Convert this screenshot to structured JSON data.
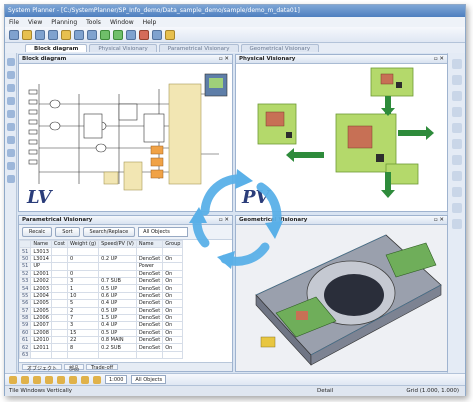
{
  "window": {
    "title": "System Planner - [C:/SystemPlanner/SP_Info_demo/Data_sample_demo/sample/demo_m_data01]"
  },
  "menu": [
    "File",
    "View",
    "Planning",
    "Tools",
    "Window",
    "Help"
  ],
  "tabs": [
    {
      "label": "Block diagram",
      "active": true
    },
    {
      "label": "Physical Visionary",
      "active": false
    },
    {
      "label": "Parametrical Visionary",
      "active": false
    },
    {
      "label": "Geometrical Visionary",
      "active": false
    }
  ],
  "panes": {
    "block": {
      "title": "Block diagram",
      "mark": "LV"
    },
    "physical": {
      "title": "Physical Visionary",
      "mark": "PV"
    },
    "parametrical": {
      "title": "Parametrical Visionary",
      "buttons": [
        "Recalc",
        "Sort",
        "Search/Replace"
      ],
      "filter": "All Objects",
      "columns": [
        "Name",
        "Cost",
        "Weight (g)",
        "Speed/PV (V)",
        "Name",
        "Group"
      ],
      "rows": [
        [
          "51",
          "L3013",
          "",
          "",
          "",
          "",
          ""
        ],
        [
          "50",
          "L3014",
          "",
          "0",
          "0.2 UP",
          "DenoSet",
          "On"
        ],
        [
          "51",
          "UP",
          "",
          "",
          "",
          "Power",
          ""
        ],
        [
          "52",
          "L2001",
          "",
          "0",
          "",
          "DenoSet",
          "On"
        ],
        [
          "53",
          "L2002",
          "",
          "3",
          "0.7 SUB",
          "DenoSet",
          "On"
        ],
        [
          "54",
          "L2003",
          "",
          "1",
          "0.5 UP",
          "DenoSet",
          "On"
        ],
        [
          "55",
          "L2004",
          "",
          "10",
          "0.6 UP",
          "DenoSet",
          "On"
        ],
        [
          "56",
          "L2005",
          "",
          "5",
          "0.4 UP",
          "DenoSet",
          "On"
        ],
        [
          "57",
          "L2005",
          "",
          "2",
          "0.5 UP",
          "DenoSet",
          "On"
        ],
        [
          "58",
          "L2006",
          "",
          "7",
          "1.5 UP",
          "DenoSet",
          "On"
        ],
        [
          "59",
          "L2007",
          "",
          "3",
          "0.4 UP",
          "DenoSet",
          "On"
        ],
        [
          "60",
          "L2008",
          "",
          "15",
          "0.5 UP",
          "DenoSet",
          "On"
        ],
        [
          "61",
          "L2010",
          "",
          "22",
          "0.8 MAIN",
          "DenoSet",
          "On"
        ],
        [
          "62",
          "L2011",
          "",
          "8",
          "0.2 SUB",
          "DenoSet",
          "On"
        ],
        [
          "63",
          "",
          "",
          "",
          "",
          "",
          ""
        ]
      ],
      "bottom_tabs": [
        "オブジェクト",
        "部品",
        "Trade-off"
      ]
    },
    "geometrical": {
      "title": "Geometrical Visionary"
    }
  },
  "bottombar": {
    "zoom": "1:000",
    "filter": "All Objects"
  },
  "status": {
    "left": "Tile Windows Vertically",
    "mid": "Detail",
    "right": "Grid (1.000, 1.000)"
  }
}
